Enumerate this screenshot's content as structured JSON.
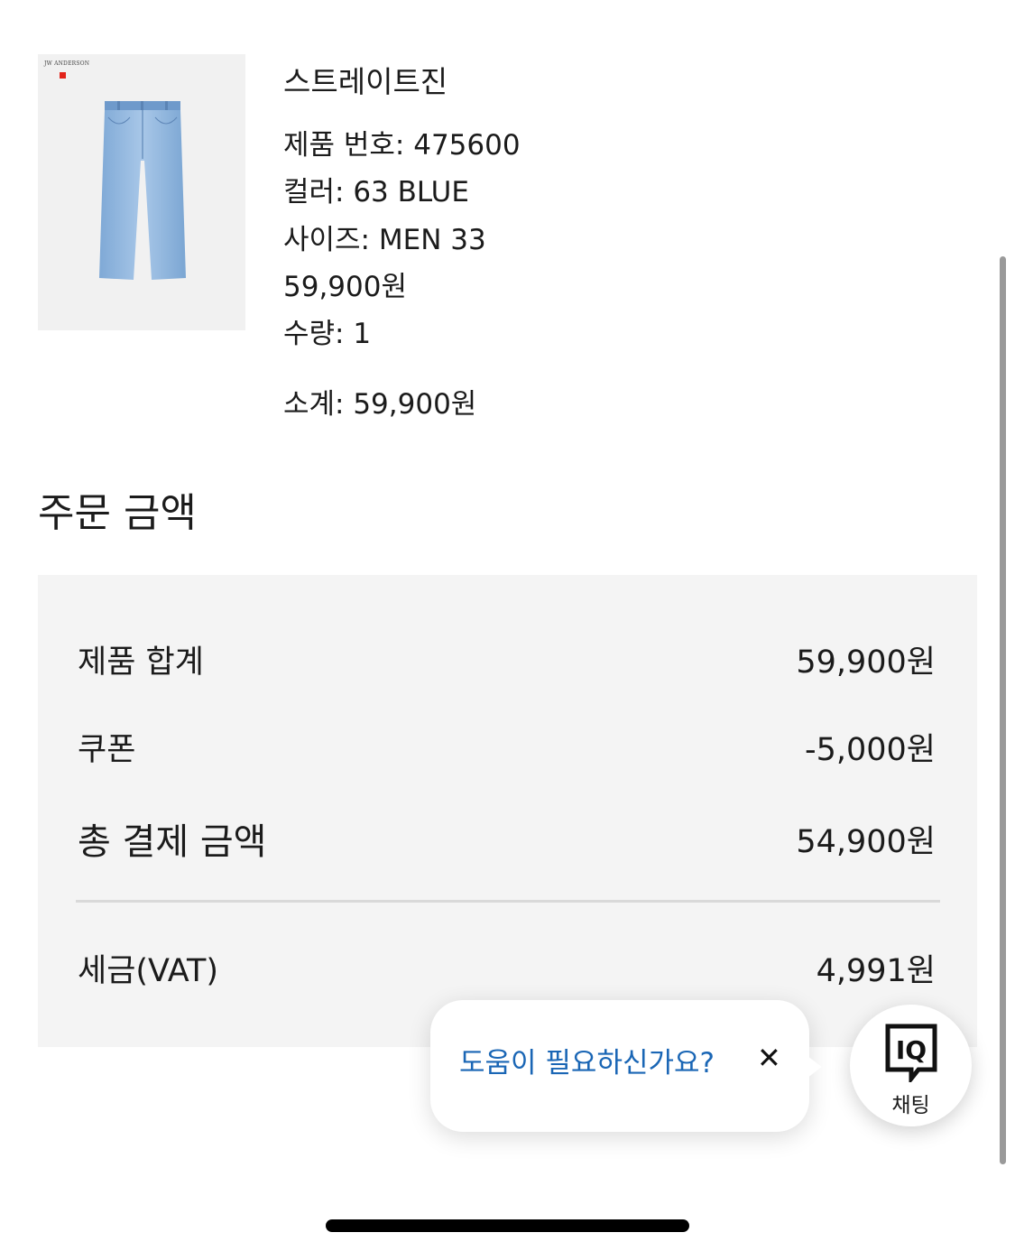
{
  "product": {
    "name": "스트레이트진",
    "number": "제품 번호: 475600",
    "color": "컬러: 63 BLUE",
    "size": "사이즈: MEN 33",
    "price": "59,900원",
    "quantity": "수량: 1",
    "subtotal": "소계: 59,900원",
    "image_icon": "jeans-image",
    "brand_mark": "JW ANDERSON"
  },
  "order_summary": {
    "title": "주문 금액",
    "rows": [
      {
        "label": "제품 합계",
        "value": "59,900원"
      },
      {
        "label": "쿠폰",
        "value": "-5,000원"
      },
      {
        "label": "총 결제 금액",
        "value": "54,900원"
      },
      {
        "label": "세금(VAT)",
        "value": "4,991원"
      }
    ]
  },
  "help_popup": {
    "text": "도움이 필요하신가요?",
    "close_icon": "close-icon",
    "text_color": "#1a66b5"
  },
  "chat": {
    "logo_text": "IQ",
    "label": "채팅"
  }
}
